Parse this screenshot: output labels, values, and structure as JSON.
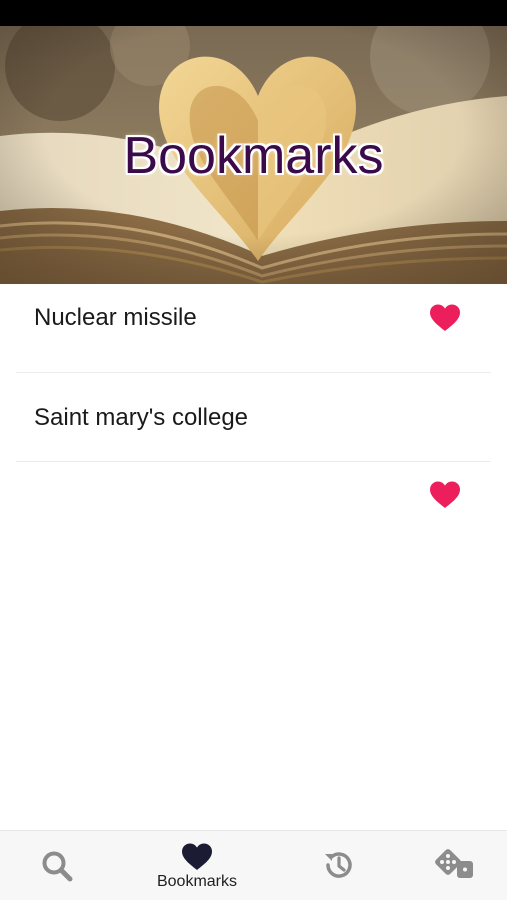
{
  "header": {
    "title": "Bookmarks"
  },
  "bookmarks": [
    {
      "label": "Nuclear missile",
      "icon": "heart-icon",
      "bookmarked": true
    },
    {
      "label": "Saint mary's college",
      "icon": "heart-icon",
      "bookmarked": true
    }
  ],
  "tab_bar": {
    "tabs": [
      {
        "icon": "search-icon",
        "label": "",
        "active": false
      },
      {
        "icon": "heart-icon",
        "label": "Bookmarks",
        "active": true
      },
      {
        "icon": "history-icon",
        "label": "",
        "active": false
      },
      {
        "icon": "dice-icon",
        "label": "",
        "active": false
      }
    ]
  },
  "colors": {
    "status_bar": "#000000",
    "heart": "#ec1e5b",
    "title_text": "#3a0a4a",
    "tab_icon_inactive": "#8c8c8c",
    "tab_icon_active": "#1b1b33",
    "tab_bar_bg": "#f7f7f7"
  }
}
